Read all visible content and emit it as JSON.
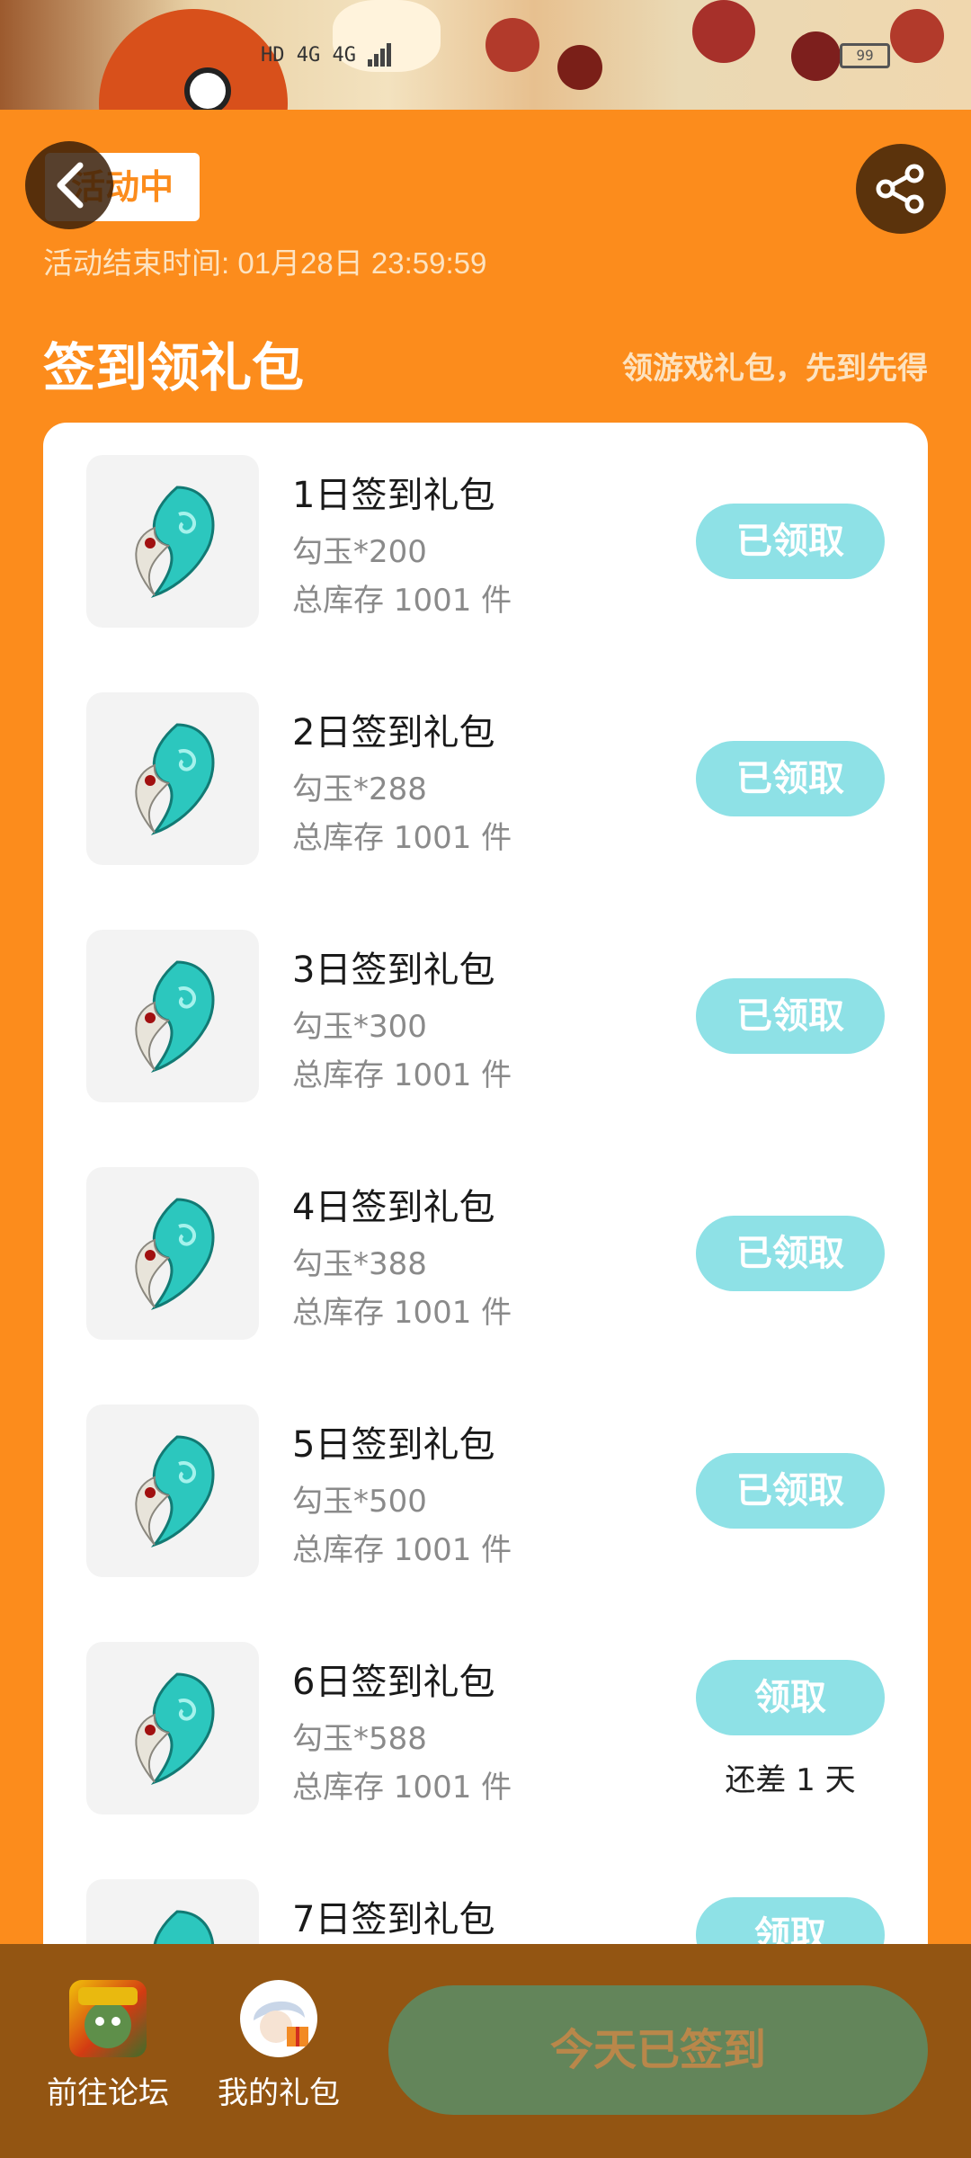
{
  "status_bar": {
    "left_text": "HD 4G 4G",
    "battery": "99"
  },
  "header": {
    "status_label": "活动中",
    "end_time": "活动结束时间: 01月28日 23:59:59"
  },
  "section": {
    "title": "签到领礼包",
    "subtitle": "领游戏礼包，先到先得"
  },
  "items": [
    {
      "title": "1日签到礼包",
      "reward": "勾玉*200",
      "stock": "总库存 1001 件",
      "button": "已领取",
      "note": ""
    },
    {
      "title": "2日签到礼包",
      "reward": "勾玉*288",
      "stock": "总库存 1001 件",
      "button": "已领取",
      "note": ""
    },
    {
      "title": "3日签到礼包",
      "reward": "勾玉*300",
      "stock": "总库存 1001 件",
      "button": "已领取",
      "note": ""
    },
    {
      "title": "4日签到礼包",
      "reward": "勾玉*388",
      "stock": "总库存 1001 件",
      "button": "已领取",
      "note": ""
    },
    {
      "title": "5日签到礼包",
      "reward": "勾玉*500",
      "stock": "总库存 1001 件",
      "button": "已领取",
      "note": ""
    },
    {
      "title": "6日签到礼包",
      "reward": "勾玉*588",
      "stock": "总库存 1001 件",
      "button": "领取",
      "note": "还差 1 天"
    },
    {
      "title": "7日签到礼包",
      "reward": "",
      "stock": "",
      "button": "领取",
      "note": ""
    }
  ],
  "bottom": {
    "forum_label": "前往论坛",
    "gifts_label": "我的礼包",
    "signin_label": "今天已签到"
  },
  "colors": {
    "background": "#FC8C1C",
    "claimed_button": "#8ee1e6",
    "bottom_bar": "#935512",
    "signin_button": "#63855a"
  },
  "icons": [
    "back-icon",
    "share-icon",
    "jade-icon",
    "forum-avatar",
    "gift-avatar"
  ]
}
